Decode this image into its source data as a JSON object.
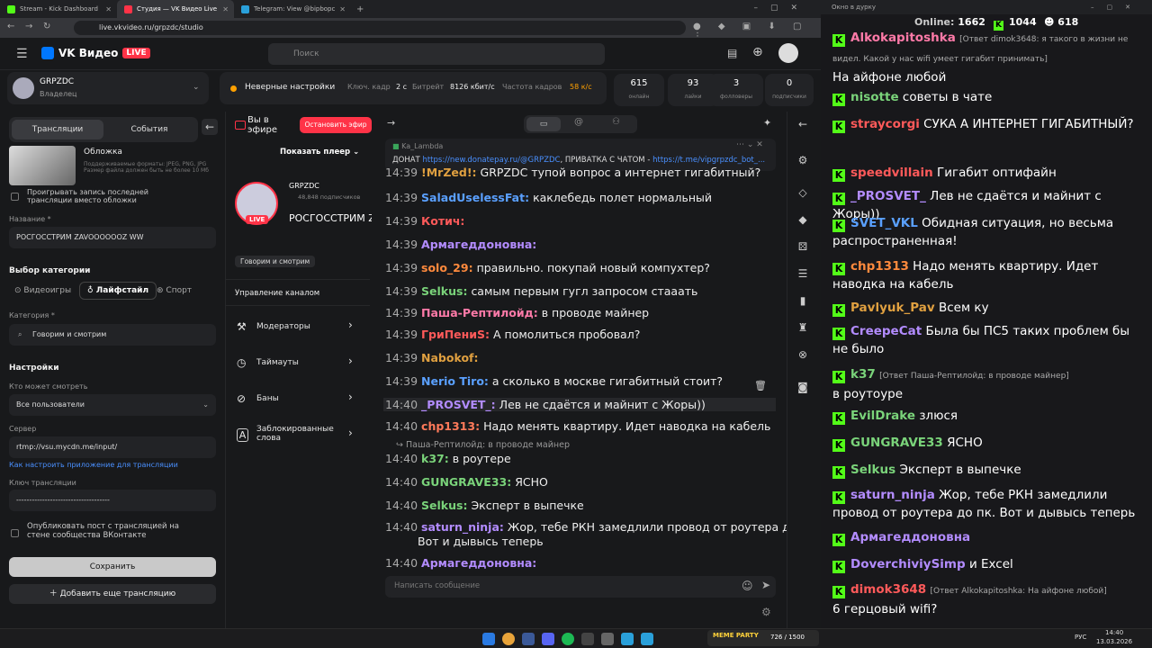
{
  "browser": {
    "tabs": [
      {
        "label": "Stream - Kick Dashboard"
      },
      {
        "label": "Студия — VK Видео Live"
      },
      {
        "label": "Telegram: View @bipbopc"
      }
    ],
    "url": "live.vkvideo.ru/grpzdc/studio"
  },
  "site": {
    "brand": "VK Видео",
    "live_badge": "LIVE",
    "search_placeholder": "Поиск"
  },
  "channel": {
    "name": "GRPZDC",
    "role": "Владелец"
  },
  "status": {
    "warning": "Неверные настройки",
    "keyframe_label": "Ключ. кадр",
    "keyframe_value": "2 с",
    "bitrate_label": "Битрейт",
    "bitrate_value": "8126 кбит/с",
    "fps_label": "Частота кадров",
    "fps_value": "58 к/с"
  },
  "stats": [
    {
      "value": "615",
      "label": "онлайн"
    },
    {
      "value": "93",
      "label": "лайки"
    },
    {
      "value": "3",
      "label": "фолловеры"
    },
    {
      "value": "0",
      "label": "подписчики"
    }
  ],
  "sidebar": {
    "tab_streams": "Трансляции",
    "tab_events": "События",
    "cover_title": "Обложка",
    "cover_hint": "Поддерживаемые форматы: JPEG, PNG, JPG Размер файла должен быть не более 10 Мб",
    "replay_option": "Проигрывать запись последней трансляции вместо обложки",
    "name_label": "Название *",
    "name_value": "РОСГОССТРИМ ZAVOOOOOOZ WW",
    "category_section": "Выбор категории",
    "cat_games": "Видеоигры",
    "cat_lifestyle": "Лайфстайл",
    "cat_sport": "Спорт",
    "category_label": "Категория *",
    "category_value": "Говорим и смотрим",
    "settings_title": "Настройки",
    "who_label": "Кто может смотреть",
    "who_value": "Все пользователи",
    "server_label": "Сервер",
    "server_value": "rtmp://vsu.mycdn.me/input/",
    "setup_link": "Как настроить приложение для трансляции",
    "key_label": "Ключ трансляции",
    "key_value": "------------------------------------",
    "publish_option": "Опубликовать пост с трансляцией на стене сообщества ВКонтакте",
    "save": "Сохранить",
    "add_stream": "Добавить еще трансляцию"
  },
  "player": {
    "on_air": "Вы в эфире",
    "stop": "Остановить эфир",
    "show_player": "Показать плеер",
    "channel": "GRPZDC",
    "subs": "48,848 подписчиков",
    "title": "РОСГОССТРИМ ZAVOOOOOOZ WW",
    "tag": "Говорим и смотрим"
  },
  "manage": {
    "title": "Управление каналом",
    "items": [
      {
        "label": "Модераторы"
      },
      {
        "label": "Таймауты"
      },
      {
        "label": "Баны"
      },
      {
        "label": "Заблокированные слова"
      }
    ]
  },
  "pinned": {
    "author": "Ka_Lambda",
    "text_prefix": "ДОНАТ",
    "link1": "https://new.donatepay.ru/@GRPZDC",
    "text_mid": ", ПРИВАТКА С ЧАТОМ -",
    "link2": "https://t.me/vipgrpzdc_bot_..."
  },
  "chat": {
    "messages": [
      {
        "time": "14:39",
        "user": "!MrZed!:",
        "color": "#e0a040",
        "text": "GRPZDC тупой вопрос а интернет гигабитный?"
      },
      {
        "time": "14:39",
        "user": "SaladUselessFat:",
        "color": "#5aa0ff",
        "text": "каклебедь   полет нормальный"
      },
      {
        "time": "14:39",
        "user": "Котич:",
        "color": "#ff5a5a",
        "text": ""
      },
      {
        "time": "14:39",
        "user": "Армагеддоновна:",
        "color": "#b38cff",
        "text": ""
      },
      {
        "time": "14:39",
        "user": "solo_29:",
        "color": "#ff8a3d",
        "text": "правильно. покупай новый компухтер?"
      },
      {
        "time": "14:39",
        "user": "Selkus:",
        "color": "#7ad37a",
        "text": "самым первым гугл запросом стааать"
      },
      {
        "time": "14:39",
        "user": "Паша-Рептилойд:",
        "color": "#ff7aa8",
        "text": "в проводе майнер"
      },
      {
        "time": "14:39",
        "user": "ГриПениS:",
        "color": "#ff5a5a",
        "text": "А помолиться пробовал?"
      },
      {
        "time": "14:39",
        "user": "Nabokof:",
        "color": "#e0a040",
        "text": ""
      },
      {
        "time": "14:39",
        "user": "Nerio Tiro:",
        "color": "#5aa0ff",
        "text": "а сколько в москве гигабитный стоит?"
      },
      {
        "time": "14:40",
        "user": "_PROSVET_:",
        "color": "#b38cff",
        "text": "Лев не сдаётся и майнит с Жоры))"
      },
      {
        "time": "14:40",
        "user": "chp1313:",
        "color": "#ff7a5a",
        "text": "Надо менять квартиру. Идет наводка на кабель"
      },
      {
        "time": "14:40",
        "user": "k37:",
        "color": "#7ad37a",
        "text": "в роутере"
      },
      {
        "time": "14:40",
        "user": "GUNGRAVE33:",
        "color": "#7ad37a",
        "text": "ЯСНО"
      },
      {
        "time": "14:40",
        "user": "Selkus:",
        "color": "#7ad37a",
        "text": "Эксперт в выпечке"
      },
      {
        "time": "14:40",
        "user": "saturn_ninja:",
        "color": "#b38cff",
        "text": "Жор, тебе РКН замедлили провод от роутера до пк."
      },
      {
        "time": "14:40",
        "user": "Армагеддоновна:",
        "color": "#b38cff",
        "text": ""
      }
    ],
    "reply_hint": "Паша-Рептилойд: в проводе майнер",
    "wrap_line": "Вот и дывысь теперь",
    "input_placeholder": "Написать сообщение"
  },
  "kick": {
    "window_title": "Окно в дурку",
    "online_label": "Online:",
    "online_value": "1662",
    "count1": "1044",
    "count2": "618",
    "messages": [
      {
        "user": "Alkokapitoshka",
        "color": "#ff7aa8",
        "reply": "[Ответ dimok3648: я такого в жизни не видел. Какой у нас wifi умеет гигабит принимать]",
        "text": "На айфоне любой"
      },
      {
        "user": "nisotte",
        "color": "#7ad37a",
        "reply": "",
        "text": "советы в чате"
      },
      {
        "user": "straycorgi",
        "color": "#ff5a5a",
        "reply": "",
        "text": "СУКА       А ИНТЕРНЕТ ГИГАБИТНЫЙ?"
      },
      {
        "user": "speedvillain",
        "color": "#ff5a5a",
        "reply": "",
        "text": "Гигабит оптифайн"
      },
      {
        "user": "_PROSVET_",
        "color": "#b38cff",
        "reply": "",
        "text": "Лев не сдаётся и майнит с Жоры))"
      },
      {
        "user": "SVET_VKL",
        "color": "#5aa0ff",
        "reply": "",
        "text": "Обидная ситуация, но весьма распространенная!"
      },
      {
        "user": "chp1313",
        "color": "#ff8a3d",
        "reply": "",
        "text": "Надо менять квартиру. Идет наводка на кабель"
      },
      {
        "user": "Pavlyuk_Pav",
        "color": "#e0a040",
        "reply": "",
        "text": "Всем ку"
      },
      {
        "user": "CreepeCat",
        "color": "#b38cff",
        "reply": "",
        "text": "Была бы ПС5 таких проблем бы не было"
      },
      {
        "user": "k37",
        "color": "#7ad37a",
        "reply": "[Ответ Паша-Рептилойд: в проводе майнер]",
        "text": "в роутоуре"
      },
      {
        "user": "EvilDrake",
        "color": "#7ad37a",
        "reply": "",
        "text": "злюся"
      },
      {
        "user": "GUNGRAVE33",
        "color": "#7ad37a",
        "reply": "",
        "text": "ЯСНО"
      },
      {
        "user": "Selkus",
        "color": "#7ad37a",
        "reply": "",
        "text": "Эксперт в выпечке"
      },
      {
        "user": "saturn_ninja",
        "color": "#b38cff",
        "reply": "",
        "text": "Жор, тебе РКН замедлили провод от роутера до пк. Вот и дывысь теперь"
      },
      {
        "user": "Армагеддоновна",
        "color": "#b38cff",
        "reply": "",
        "text": ""
      },
      {
        "user": "DoverchiviySimp",
        "color": "#b38cff",
        "reply": "",
        "text": "и Excel"
      },
      {
        "user": "dimok3648",
        "color": "#ff5a5a",
        "reply": "[Ответ Alkokapitoshka: На айфоне любой]",
        "text": "6 герцовый wifi?"
      }
    ]
  },
  "taskbar": {
    "lang": "РУС",
    "time": "14:40",
    "date": "13.03.2026",
    "game_tag": "MEME PARTY",
    "game_counter": "726 / 1500"
  }
}
